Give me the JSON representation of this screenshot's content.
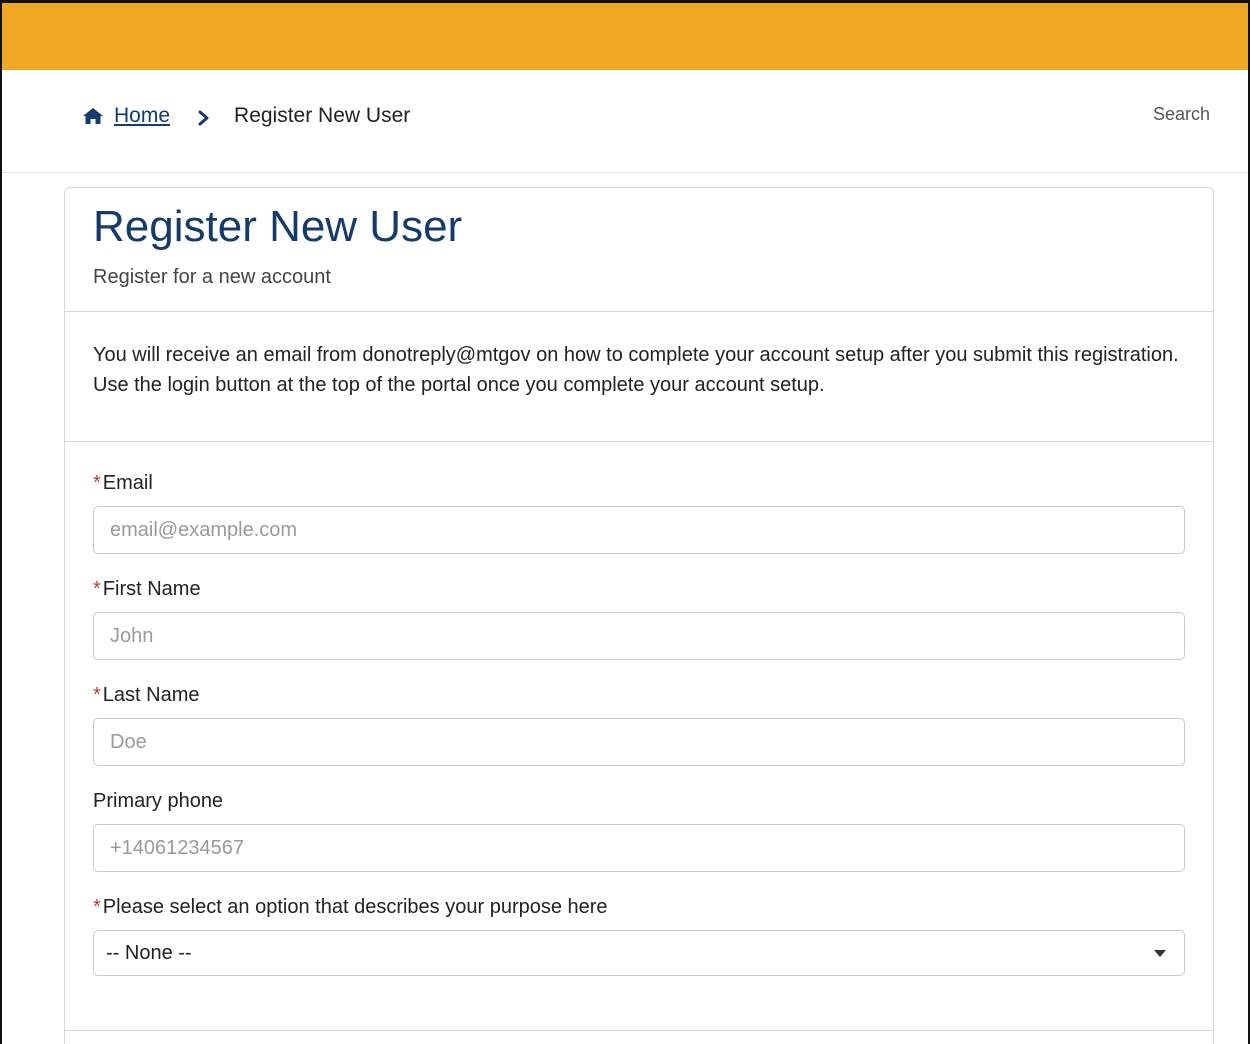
{
  "colors": {
    "top_bar": "#eea823",
    "title": "#143b6b",
    "required_marker": "#c0392b"
  },
  "breadcrumb": {
    "home_label": "Home",
    "current_label": "Register New User",
    "home_icon": "home-icon",
    "separator_icon": "chevron-right-icon"
  },
  "header": {
    "search_label": "Search"
  },
  "card": {
    "title": "Register New User",
    "subtitle": "Register for a new account",
    "info_text": "You will receive an email from donotreply@mtgov on how to complete your account setup after you submit this registration. Use the login button at the top of the portal once you complete your account setup."
  },
  "form": {
    "required_marker": "*",
    "email": {
      "label": "Email",
      "placeholder": "email@example.com",
      "value": ""
    },
    "first_name": {
      "label": "First Name",
      "placeholder": "John",
      "value": ""
    },
    "last_name": {
      "label": "Last Name",
      "placeholder": "Doe",
      "value": ""
    },
    "phone": {
      "label": "Primary phone",
      "placeholder": "+14061234567",
      "value": ""
    },
    "purpose": {
      "label": "Please select an option that describes your purpose here",
      "selected": "-- None --"
    }
  }
}
